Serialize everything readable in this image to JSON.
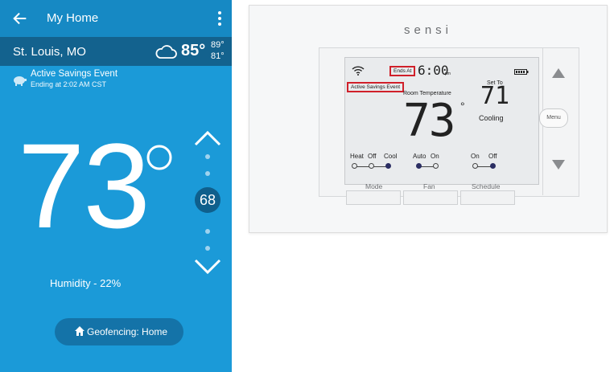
{
  "app": {
    "title": "My Home",
    "location": "St. Louis, MO",
    "weather": {
      "icon": "cloud-icon",
      "temp": "85°",
      "high": "89°",
      "low": "81°"
    },
    "savings": {
      "title": "Active Savings Event",
      "subtitle": "Ending at 2:02 AM CST"
    },
    "current_temp": "73",
    "setpoint": "68",
    "humidity": "Humidity - 22%",
    "geofencing": "Geofencing: Home",
    "colors": {
      "primary": "#1b9ad8",
      "appbar": "#1689c4",
      "location_bar": "#13628e",
      "setpoint_bg": "#0f5f8c"
    }
  },
  "device": {
    "brand": "sensi",
    "screen": {
      "ends_at": "Ends At",
      "time": "6:00",
      "pm": "pm",
      "active_event": "Active Savings Event",
      "room_label": "Room Temperature",
      "room_temp": "73",
      "set_to_label": "Set To",
      "set_temp": "71",
      "mode_status": "Cooling",
      "mode_options": {
        "heat": "Heat",
        "off": "Off",
        "cool": "Cool"
      },
      "fan_options": {
        "auto": "Auto",
        "on": "On"
      },
      "schedule_options": {
        "on": "On",
        "off": "Off"
      }
    },
    "buttons": {
      "mode": "Mode",
      "fan": "Fan",
      "schedule": "Schedule",
      "menu": "Menu"
    },
    "highlight_color": "#d0202a"
  }
}
